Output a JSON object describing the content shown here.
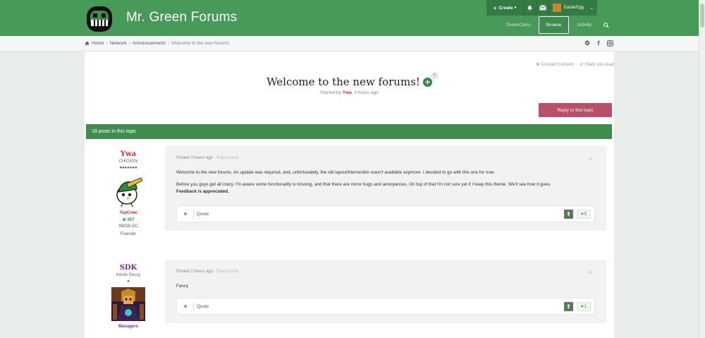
{
  "header": {
    "site_title": "Mr. Green Forums",
    "create_label": "Create",
    "username": "EasterEgg",
    "nav": [
      {
        "label": "GreenCoins"
      },
      {
        "label": "Browse"
      },
      {
        "label": "Activity"
      }
    ]
  },
  "breadcrumb": {
    "home": "Home",
    "items": [
      "Network",
      "Announcements"
    ],
    "current": "Welcome to the new forums!"
  },
  "top_actions": {
    "unread": "Unread Content",
    "mark_read": "Mark site read"
  },
  "topic": {
    "title": "Welcome to the new forums!",
    "follow_count": "1",
    "started_by_prefix": "Started by",
    "started_by_author": "Ywa",
    "started_when": ", 3 hours ago",
    "reply_label": "Reply to this topic",
    "posts_count_label": "18 posts in this topic"
  },
  "posts": [
    {
      "author": "Ywa",
      "author_color": "#d12b2b",
      "author_title": "CHICKEN",
      "pips": "●●●●●●●",
      "group": "TopCrew",
      "group_color": "#d12b2b",
      "coins": "357",
      "gc": "99028 GC",
      "role": "Founder",
      "posted": "Posted 3 hours ago",
      "report": "Report post",
      "paragraphs": [
        "Welcome to the new forums. An update was required, and, unfortunately, the old layout/theme/skin wasn't available anymore. I decided to go with this one for now.",
        "Before you guys get all crazy. I'm aware some functionality is missing, and that there are minor bugs and annoyances. On top of that I'm not sure yet if I keep this theme. We'll see how it goes."
      ],
      "bold_line": "Feedback is appreciated.",
      "quote": "Quote",
      "likes": "5"
    },
    {
      "author": "SDK",
      "author_color": "#7d2b8a",
      "author_title": "Horde Decoy",
      "pips": "●",
      "group": "Managers",
      "group_color": "#7d2b8a",
      "posted": "Posted 2 hours ago",
      "report": "Report post",
      "paragraphs": [
        "Fancy"
      ],
      "quote": "Quote",
      "likes": "1"
    }
  ],
  "colors": {
    "header_green": "#489a58",
    "posts_bar": "#3f8c4f",
    "reply_btn": "#b84f6c"
  }
}
